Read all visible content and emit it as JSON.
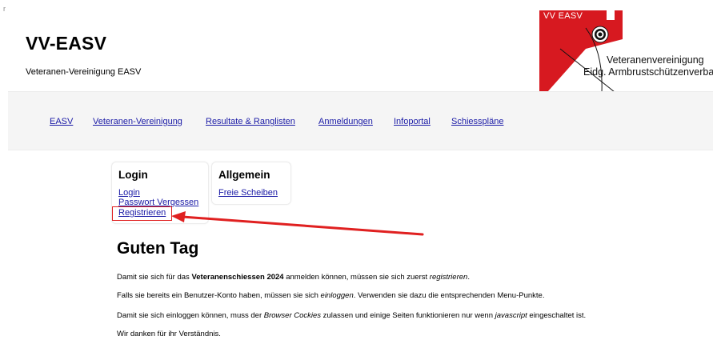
{
  "corner_mark": "r",
  "site": {
    "title": "VV-EASV",
    "subtitle": "Veteranen-Vereinigung EASV"
  },
  "logo": {
    "abbrev": "VV EASV",
    "line1": "Veteranenvereinigung",
    "line2": "Eidg. Armbrustschützenverband",
    "colors": {
      "red": "#d71920",
      "white": "#ffffff",
      "black": "#111111"
    }
  },
  "nav": {
    "items": [
      {
        "label": "EASV"
      },
      {
        "label": "Veteranen-Vereinigung"
      },
      {
        "label": "Resultate & Ranglisten"
      },
      {
        "label": "Anmeldungen"
      },
      {
        "label": "Infoportal"
      },
      {
        "label": "Schiesspläne"
      }
    ]
  },
  "cards": {
    "login": {
      "title": "Login",
      "links": [
        "Login",
        "Passwort Vergessen",
        "Registrieren"
      ]
    },
    "allgemein": {
      "title": "Allgemein",
      "links": [
        "Freie Scheiben"
      ]
    }
  },
  "annotation": {
    "color": "#e02020"
  },
  "main": {
    "heading": "Guten Tag",
    "p1": {
      "a": "Damit sie sich für das ",
      "b": "Veteranenschiessen 2024",
      "c": " anmelden können, müssen sie sich zuerst ",
      "d": "registrieren",
      "e": "."
    },
    "p2": {
      "a": "Falls sie bereits ein Benutzer-Konto haben, müssen sie sich ",
      "b": "einloggen",
      "c": ". Verwenden sie dazu die entsprechenden Menu-Punkte."
    },
    "p3": {
      "a": "Damit sie sich einloggen können, muss der ",
      "b": "Browser Cockies",
      "c": " zulassen und einige Seiten funktionieren nur wenn ",
      "d": "javascript",
      "e": " eingeschaltet ist."
    },
    "p4": "Wir danken für ihr Verständnis."
  }
}
